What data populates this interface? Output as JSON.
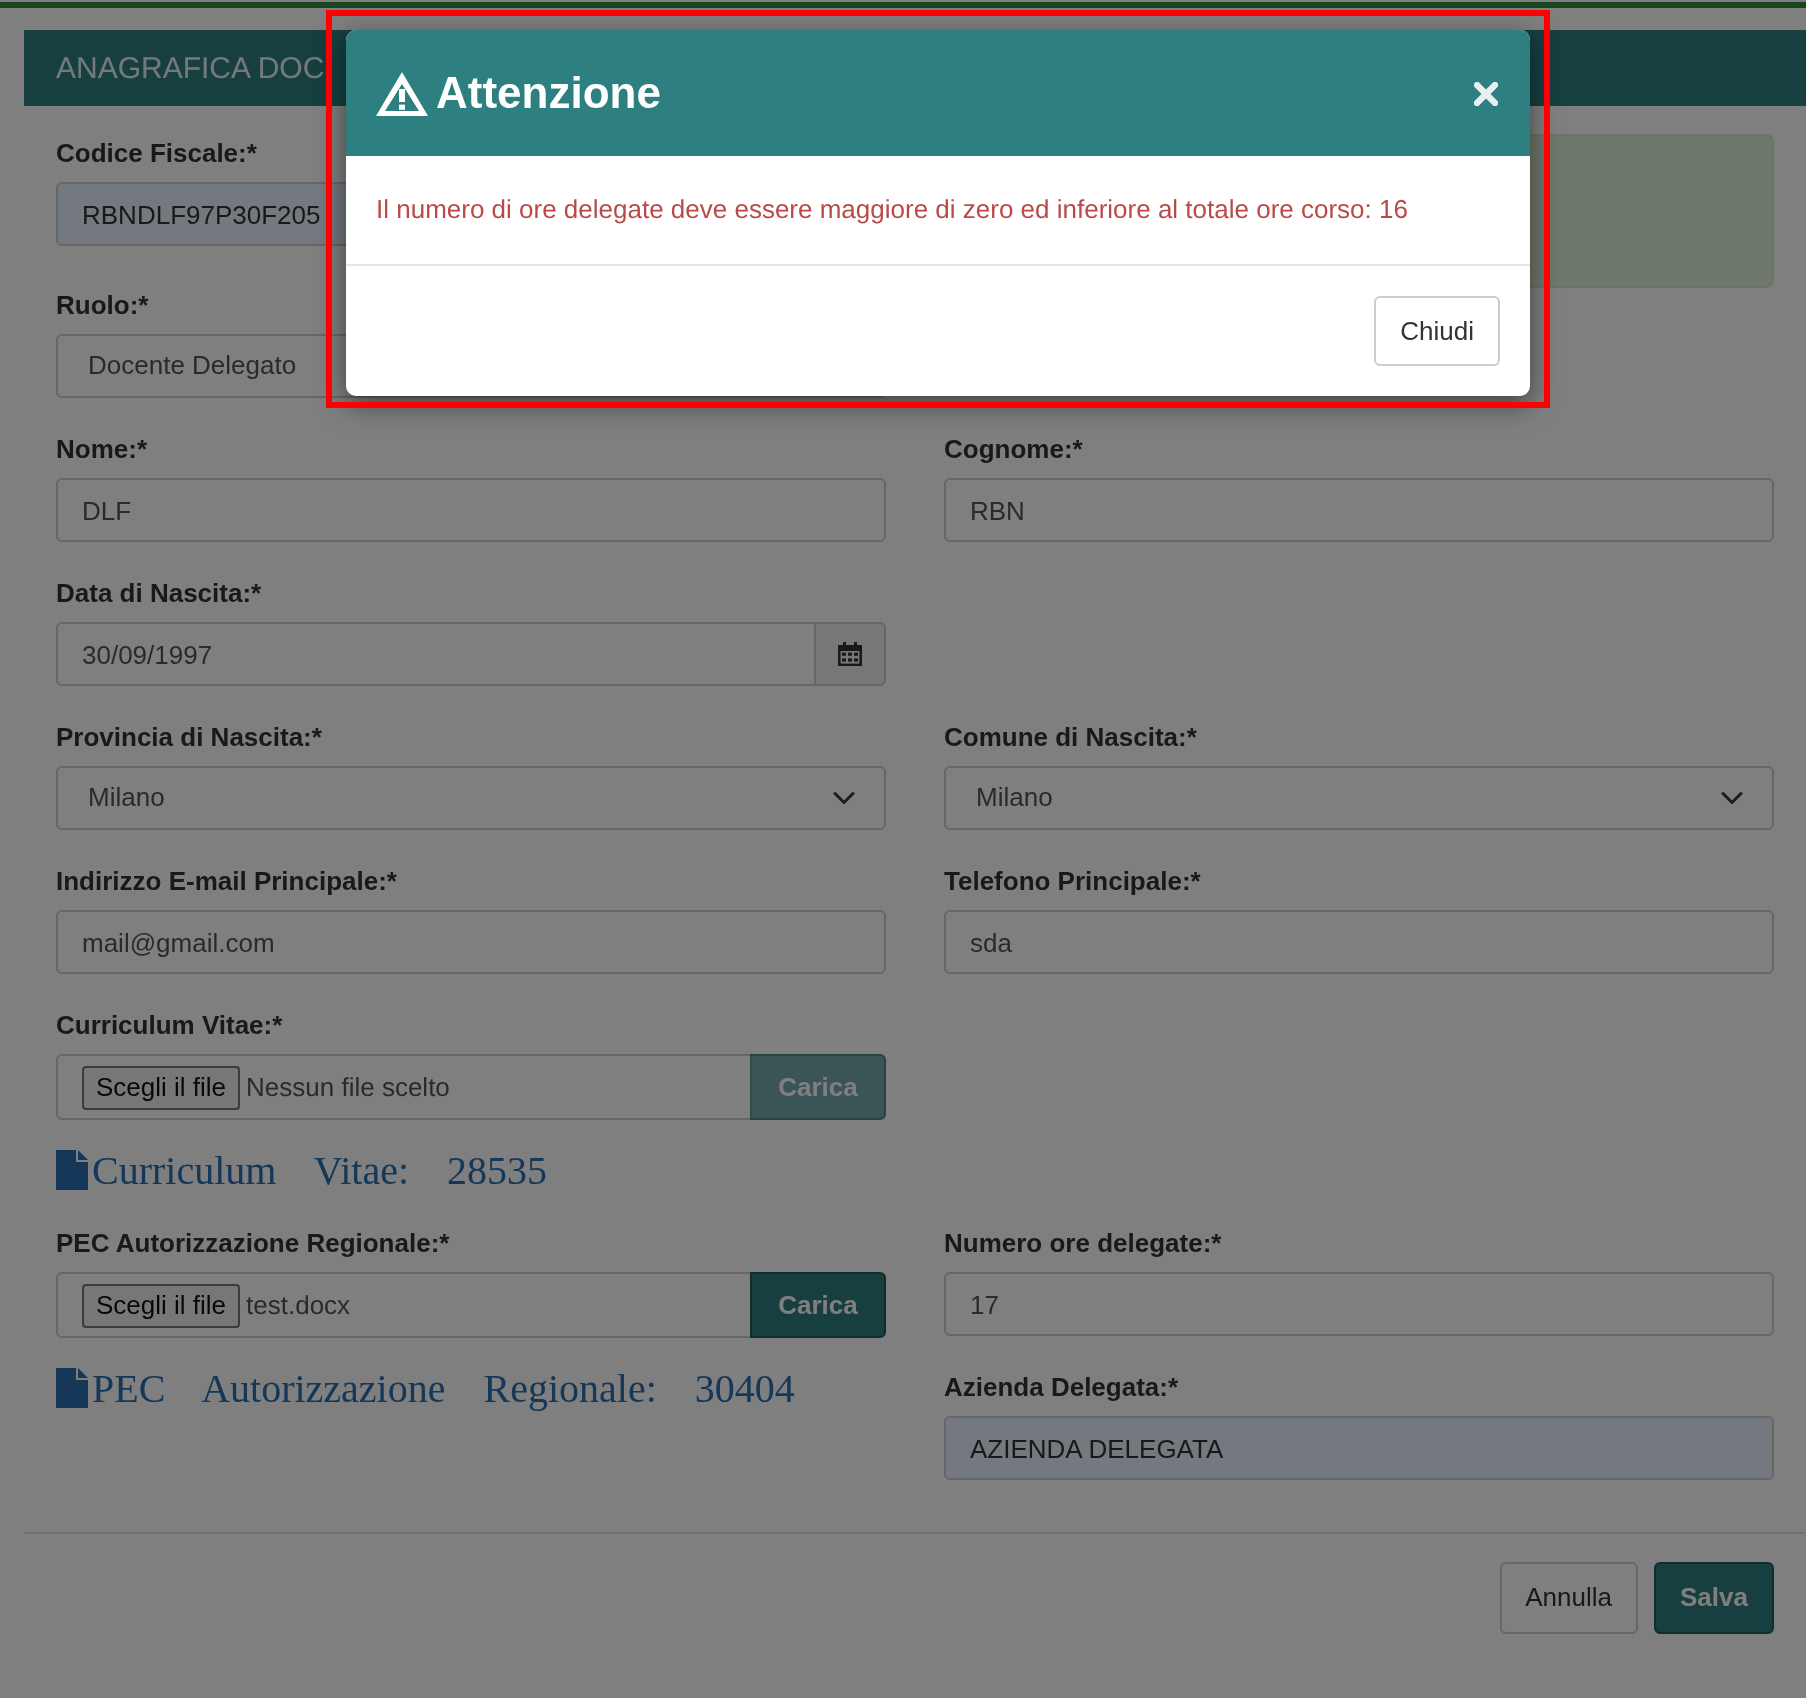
{
  "form_modal": {
    "title": "ANAGRAFICA DOC",
    "rows": [
      {
        "left": [
          {
            "kind": "text",
            "label": "Codice Fiscale:*",
            "value": "RBNDLF97P30F205",
            "readonly": true
          }
        ],
        "right": [
          {
            "kind": "notice"
          }
        ]
      },
      {
        "left": [
          {
            "kind": "select",
            "label": "Ruolo:*",
            "value": "Docente Delegato"
          }
        ]
      },
      {
        "left": [
          {
            "kind": "text",
            "label": "Nome:*",
            "value": "DLF",
            "readonly": false
          }
        ],
        "right": [
          {
            "kind": "text",
            "label": "Cognome:*",
            "value": "RBN",
            "readonly": false
          }
        ]
      },
      {
        "left": [
          {
            "kind": "date",
            "label": "Data di Nascita:*",
            "value": "30/09/1997"
          }
        ]
      },
      {
        "left": [
          {
            "kind": "select",
            "label": "Provincia di Nascita:*",
            "value": "Milano"
          }
        ],
        "right": [
          {
            "kind": "select",
            "label": "Comune di Nascita:*",
            "value": "Milano"
          }
        ]
      },
      {
        "left": [
          {
            "kind": "text",
            "label": "Indirizzo E-mail Principale:*",
            "value": "mail@gmail.com",
            "readonly": false
          }
        ],
        "right": [
          {
            "kind": "text",
            "label": "Telefono Principale:*",
            "value": "sda",
            "readonly": false
          }
        ]
      },
      {
        "left": [
          {
            "kind": "file",
            "label": "Curriculum Vitae:*",
            "choose": "Scegli il file",
            "filename": "Nessun file scelto",
            "upload": "Carica",
            "disabled": true,
            "document": "Curriculum Vitae: 28535"
          }
        ]
      },
      {
        "left": [
          {
            "kind": "file",
            "label": "PEC Autorizzazione Regionale:*",
            "choose": "Scegli il file",
            "filename": "test.docx",
            "upload": "Carica",
            "disabled": false,
            "document": "PEC Autorizzazione Regionale: 30404"
          }
        ],
        "right": [
          {
            "kind": "text",
            "label": "Numero ore delegate:*",
            "value": "17",
            "readonly": false
          },
          {
            "kind": "text",
            "label": "Azienda Delegata:*",
            "value": "AZIENDA DELEGATA",
            "readonly": true
          }
        ]
      }
    ],
    "buttons": [
      {
        "label": "Annulla",
        "kind": "secondary"
      },
      {
        "label": "Salva",
        "kind": "primary"
      }
    ]
  },
  "alert": {
    "title": "Attenzione",
    "message": "Il numero di ore delegate deve essere maggiore di zero ed inferiore al totale ore corso: 16",
    "buttons": [
      "Chiudi"
    ]
  }
}
